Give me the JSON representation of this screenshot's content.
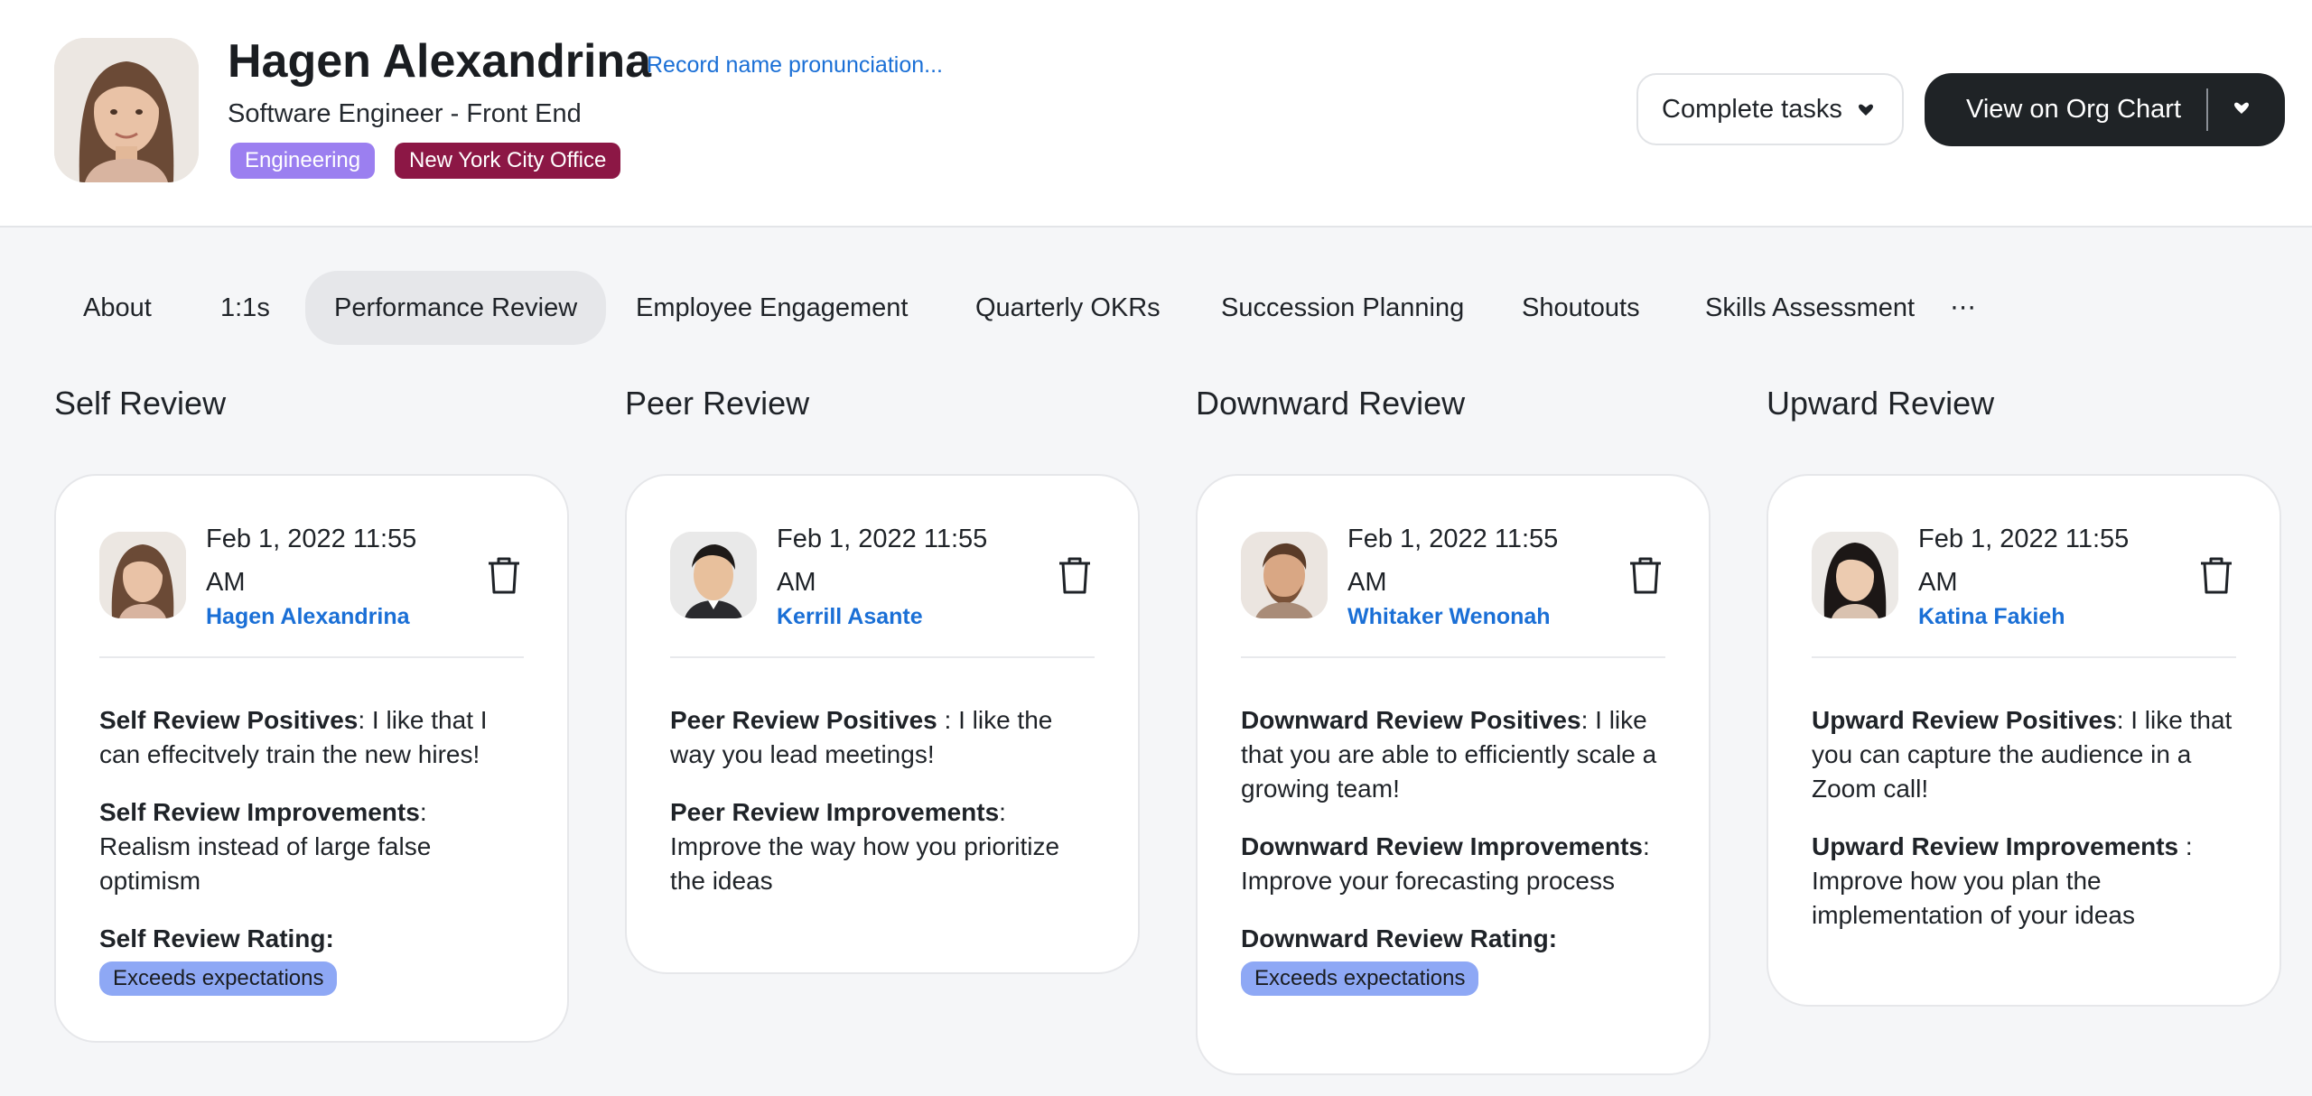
{
  "profile": {
    "name": "Hagen Alexandrina",
    "pronunciation_link": "Record name pronunciation...",
    "title": "Software Engineer - Front End",
    "tags": [
      {
        "label": "Engineering",
        "color": "#9b7ff0"
      },
      {
        "label": "New York City Office",
        "color": "#8c1745"
      }
    ]
  },
  "actions": {
    "complete_tasks": "Complete tasks",
    "org_chart": "View on Org Chart",
    "org_chart_color": "#1f2326"
  },
  "tabs": [
    {
      "label": "About"
    },
    {
      "label": "1:1s"
    },
    {
      "label": "Performance Review",
      "active": true
    },
    {
      "label": "Employee Engagement"
    },
    {
      "label": "Quarterly OKRs"
    },
    {
      "label": "Succession Planning"
    },
    {
      "label": "Shoutouts"
    },
    {
      "label": "Skills Assessment"
    },
    {
      "label": "⋯"
    }
  ],
  "reviews": [
    {
      "column_title": "Self Review",
      "date": "Feb 1, 2022 11:55 AM",
      "author": "Hagen Alexandrina",
      "items": [
        {
          "label": "Self Review Positives",
          "text": ": I like that I can effecitvely train the new hires!"
        },
        {
          "label": "Self Review Improvements",
          "text": ": Realism instead of large false optimism"
        }
      ],
      "rating_label": "Self Review Rating",
      "rating_suffix": ":",
      "rating": "Exceeds expectations"
    },
    {
      "column_title": "Peer Review",
      "date": "Feb 1, 2022 11:55 AM",
      "author": "Kerrill Asante",
      "items": [
        {
          "label": "Peer Review Positives",
          "text": " : I like the way you lead meetings!"
        },
        {
          "label": "Peer Review Improvements",
          "text": ": Improve the way how you prioritize the ideas"
        }
      ]
    },
    {
      "column_title": "Downward Review",
      "date": "Feb 1, 2022 11:55 AM",
      "author": "Whitaker Wenonah",
      "items": [
        {
          "label": "Downward Review Positives",
          "text": ": I like that you are able to efficiently scale a growing team!"
        },
        {
          "label": "Downward Review Improvements",
          "text": ": Improve your forecasting process"
        }
      ],
      "rating_label": "Downward Review Rating",
      "rating_suffix": ":",
      "rating": "Exceeds expectations"
    },
    {
      "column_title": "Upward Review",
      "date": "Feb 1, 2022 11:55 AM",
      "author": "Katina Fakieh",
      "items": [
        {
          "label": "Upward Review Positives",
          "text": ": I like that you can capture the audience in a Zoom call!"
        },
        {
          "label": "Upward Review Improvements",
          "text": " : Improve how you plan the implementation of your ideas"
        }
      ]
    }
  ],
  "icons": {
    "trash": "trash-icon",
    "caret": "caret-down-icon",
    "avatar": "avatar-photo"
  },
  "colors": {
    "link": "#1a6fd6",
    "rating_pill": "#8ea8f5",
    "tab_active_bg": "#e6e7ea"
  }
}
